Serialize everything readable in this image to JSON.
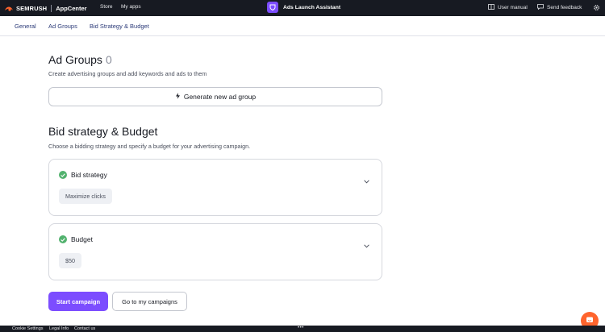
{
  "topbar": {
    "brand": "SEMRUSH",
    "product": "AppCenter",
    "nav": [
      {
        "label": "Store"
      },
      {
        "label": "My apps"
      }
    ],
    "app_title": "Ads Launch Assistant",
    "app_icon": "purple-shield-icon",
    "user_manual": "User manual",
    "send_feedback": "Send feedback",
    "settings_icon": "gear-icon"
  },
  "tabs": [
    {
      "label": "General"
    },
    {
      "label": "Ad Groups"
    },
    {
      "label": "Bid Strategy & Budget"
    }
  ],
  "ad_groups": {
    "title": "Ad Groups",
    "count": "0",
    "description": "Create advertising groups and add keywords and ads to them",
    "generate_button": "Generate new ad group",
    "generate_icon": "lightning-icon"
  },
  "bid_budget": {
    "title": "Bid strategy & Budget",
    "description": "Choose a bidding strategy and specify a budget for your advertising campaign.",
    "cards": [
      {
        "title": "Bid strategy",
        "value": "Maximize clicks",
        "status": "complete"
      },
      {
        "title": "Budget",
        "value": "$50",
        "status": "complete"
      }
    ]
  },
  "actions": {
    "primary": "Start campaign",
    "secondary": "Go to my campaigns"
  },
  "footer": {
    "links": [
      {
        "label": "Cookie Settings"
      },
      {
        "label": "Legal Info"
      },
      {
        "label": "Contact us"
      }
    ],
    "more": "•••"
  },
  "colors": {
    "topbar_bg": "#171a22",
    "accent_purple": "#7c4dff",
    "tab_text": "#2b3a78",
    "check_green": "#52b26e",
    "chat_orange": "#ff642d"
  }
}
